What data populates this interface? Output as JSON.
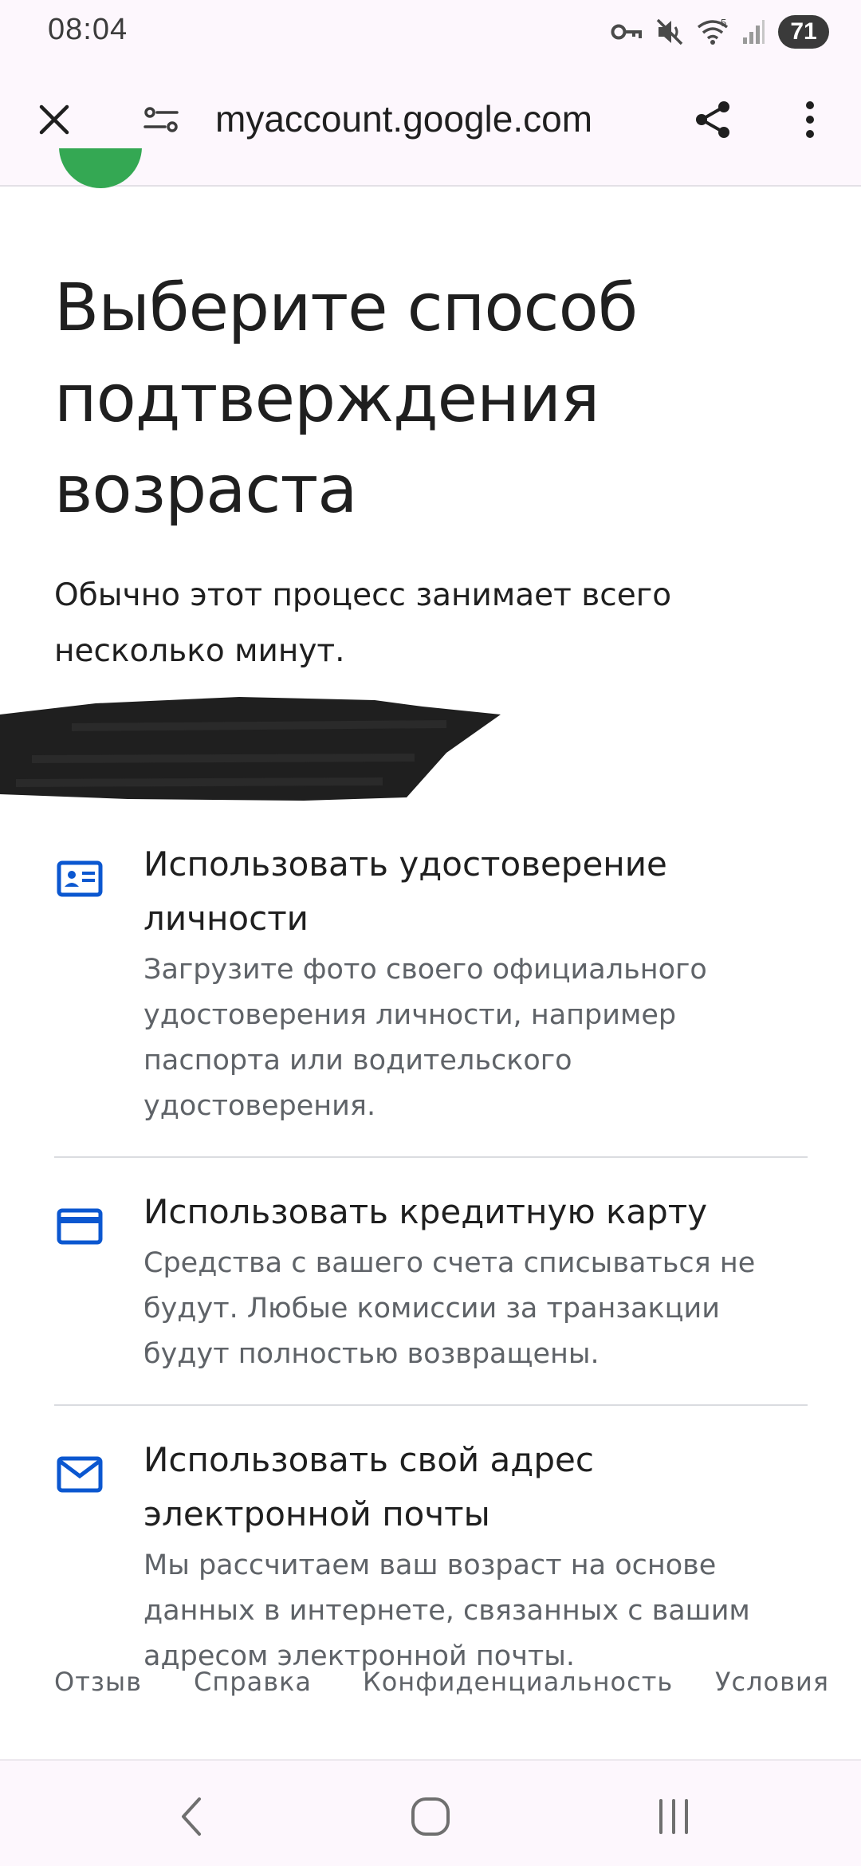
{
  "status_bar": {
    "time": "08:04",
    "battery_level": "71",
    "icons": [
      "vpn-key-icon",
      "mute-icon",
      "wifi-icon",
      "signal-icon",
      "battery-icon"
    ],
    "wifi_badge": "5"
  },
  "browser": {
    "url": "myaccount.google.com",
    "icons": {
      "close": "close-icon",
      "site_settings": "site-settings-icon",
      "share": "share-icon",
      "menu": "more-vert-icon"
    }
  },
  "page": {
    "title": "Выберите способ подтверждения возраста",
    "subtitle": "Обычно этот процесс занимает всего несколько минут.",
    "options": [
      {
        "icon": "id-card-icon",
        "title": "Использовать удостоверение личности",
        "description": "Загрузите фото своего официального удостоверения личности, например паспорта или водительского удостоверения."
      },
      {
        "icon": "credit-card-icon",
        "title": "Использовать кредитную карту",
        "description": "Средства с вашего счета списываться не будут. Любые комиссии за транзакции будут полностью возвращены."
      },
      {
        "icon": "mail-icon",
        "title": "Использовать свой адрес электронной почты",
        "description": "Мы рассчитаем ваш возраст на основе данных в интернете, связанных с вашим адресом электронной почты."
      }
    ],
    "footer_links": [
      "Отзыв",
      "Справка",
      "Конфиденциальность",
      "Условия"
    ]
  },
  "colors": {
    "icon_blue": "#0b57d0",
    "logo_green": "#34a853",
    "chrome_bg": "#fdf7fd",
    "redaction": "#1f1f1f"
  },
  "nav_bar": {
    "icons": [
      "back-icon",
      "home-icon",
      "recents-icon"
    ]
  }
}
